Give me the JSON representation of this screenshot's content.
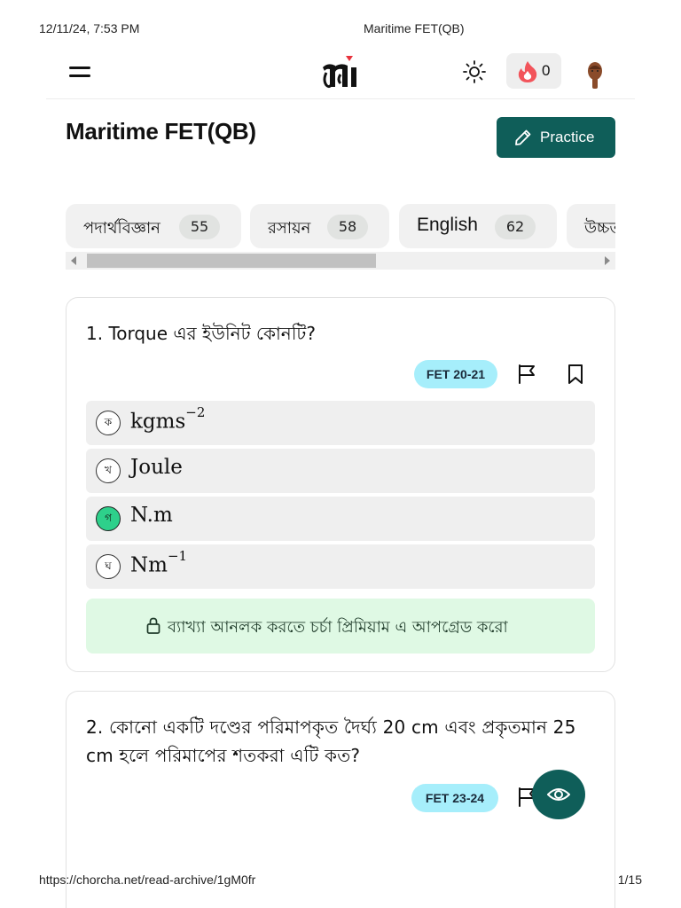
{
  "print": {
    "datetime": "12/11/24, 7:53 PM",
    "doc_title": "Maritime FET(QB)",
    "url": "https://chorcha.net/read-archive/1gM0fr",
    "page": "1/15"
  },
  "topbar": {
    "menu_icon": "hamburger-menu-icon",
    "logo_icon": "chorcha-logo",
    "theme_icon": "sun-icon",
    "streak_icon": "flame-icon",
    "streak_count": "0",
    "avatar_icon": "user-avatar"
  },
  "header": {
    "title": "Maritime FET(QB)",
    "practice_label": "Practice",
    "practice_icon": "pencil-icon"
  },
  "subjects": [
    {
      "name": "পদার্থবিজ্ঞান",
      "count": "55"
    },
    {
      "name": "রসায়ন",
      "count": "58"
    },
    {
      "name": "English",
      "count": "62"
    },
    {
      "name": "উচ্চতর",
      "count": ""
    }
  ],
  "questions": [
    {
      "text": "1. Torque এর ইউনিট কোনটি?",
      "tag": "FET 20-21",
      "options": [
        {
          "badge": "ক",
          "base": "kgms",
          "sup": "−2",
          "correct": false
        },
        {
          "badge": "খ",
          "base": "Joule",
          "sup": "",
          "correct": false
        },
        {
          "badge": "গ",
          "base": "N.m",
          "sup": "",
          "correct": true
        },
        {
          "badge": "ঘ",
          "base": "Nm",
          "sup": "−1",
          "correct": false
        }
      ],
      "premium_text": "ব্যাখ্যা আনলক করতে চর্চা প্রিমিয়াম এ আপগ্রেড করো"
    },
    {
      "text": "2. কোনো একটি দণ্ডের পরিমাপকৃত দৈর্ঘ্য 20 cm এবং প্রকৃতমান 25 cm হলে পরিমাপের শতকরা এটি কত?",
      "tag": "FET 23-24"
    }
  ],
  "colors": {
    "brand": "#0f5e59",
    "tag_bg": "#a6eefb",
    "correct": "#2ed08b",
    "premium_bg": "#dff9e4",
    "flame": "#f2545b"
  }
}
